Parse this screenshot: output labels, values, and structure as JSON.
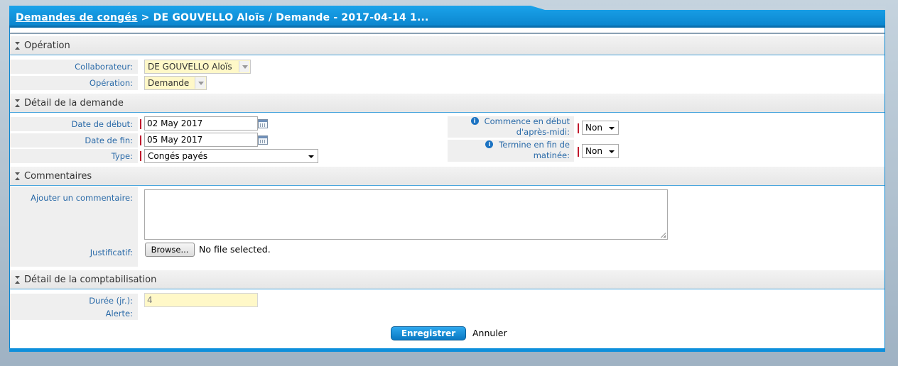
{
  "breadcrumb": {
    "link": "Demandes de congés",
    "rest": " > DE GOUVELLO Aloïs / Demande - 2017-04-14 1..."
  },
  "sections": {
    "operation": "Opération",
    "detail": "Détail de la demande",
    "comments": "Commentaires",
    "accounting": "Détail de la comptabilisation"
  },
  "operation": {
    "collaborateur_label": "Collaborateur:",
    "collaborateur_value": "DE GOUVELLO Aloïs",
    "operation_label": "Opération:",
    "operation_value": "Demande"
  },
  "detail": {
    "start_label": "Date de début:",
    "start_value": "02 May 2017",
    "end_label": "Date de fin:",
    "end_value": "05 May 2017",
    "type_label": "Type:",
    "type_value": "Congés payés",
    "afternoon_label_1": "Commence en début",
    "afternoon_label_2": "d'après-midi:",
    "afternoon_value": "Non",
    "morning_label_1": "Termine en fin de",
    "morning_label_2": "matinée:",
    "morning_value": "Non"
  },
  "comments": {
    "add_label": "Ajouter un commentaire:",
    "comment_value": "",
    "proof_label": "Justificatif:",
    "browse_label": "Browse...",
    "file_status": "No file selected."
  },
  "accounting": {
    "duration_label": "Durée (jr.):",
    "duration_value": "4",
    "alert_label": "Alerte:"
  },
  "actions": {
    "save": "Enregistrer",
    "cancel": "Annuler"
  },
  "colors": {
    "accent": "#0c86cf",
    "label_blue": "#2a6aa8",
    "readonly_bg": "#fff8c8",
    "required": "#c0182c"
  }
}
